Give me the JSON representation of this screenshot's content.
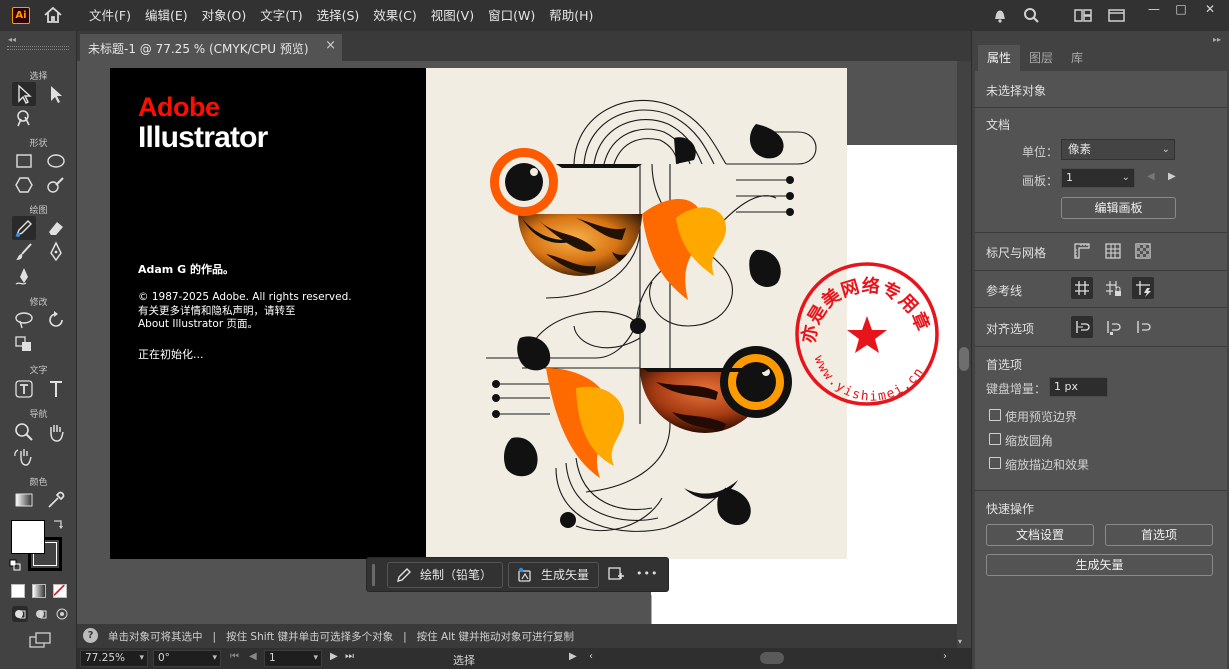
{
  "app": {
    "logo": "Ai",
    "menu": [
      "文件(F)",
      "编辑(E)",
      "对象(O)",
      "文字(T)",
      "选择(S)",
      "效果(C)",
      "视图(V)",
      "窗口(W)",
      "帮助(H)"
    ],
    "window_buttons": [
      "—",
      "□",
      "✕"
    ]
  },
  "document": {
    "tab_title": "未标题-1 @ 77.25 % (CMYK/CPU 预览)",
    "close": "×"
  },
  "toolbar": {
    "groups": [
      "选择",
      "形状",
      "绘图",
      "修改",
      "文字",
      "导航",
      "颜色"
    ]
  },
  "splash": {
    "brand_line1": "Adobe",
    "brand_line2": "Illustrator",
    "author": "Adam G 的作品。",
    "legal_line1": "© 1987-2025 Adobe. All rights reserved.",
    "legal_line2": "有关更多详情和隐私声明，请转至",
    "legal_line3": " About  Illustrator 页面。",
    "status": "正在初始化..."
  },
  "stamp": {
    "text": "亦是美网络专用章",
    "url": "www.yishimei.cn",
    "color": "#e8141b"
  },
  "context_bar": {
    "draw_label": "绘制（铅笔）",
    "vector_label": "生成矢量",
    "more": "•••"
  },
  "tips": {
    "icon": "?",
    "text": "单击对象可将其选中   |   按住 Shift 键并单击可选择多个对象   |   按住 Alt 键并拖动对象可进行复制"
  },
  "status": {
    "zoom": "77.25%",
    "rotation": "0°",
    "artboard": "1",
    "mode": "选择"
  },
  "panel": {
    "tabs": [
      "属性",
      "图层",
      "库"
    ],
    "no_selection": "未选择对象",
    "doc_section": "文档",
    "unit_label": "单位：",
    "unit_value": "像素",
    "artboard_label": "画板：",
    "artboard_value": "1",
    "edit_artboards": "编辑画板",
    "rulers_grids": "标尺与网格",
    "guides": "参考线",
    "align_options": "对齐选项",
    "prefs_section": "首选项",
    "key_incr_label": "键盘增量：",
    "key_incr_value": "1 px",
    "cb_preview_bounds": "使用预览边界",
    "cb_scale_corners": "缩放圆角",
    "cb_scale_strokes": "缩放描边和效果",
    "quick_actions": "快速操作",
    "btn_doc_setup": "文档设置",
    "btn_prefs": "首选项",
    "btn_gen_vector": "生成矢量"
  },
  "colors": {
    "adobe_red": "#fa0f00",
    "splash_bg": "#f1ede3",
    "orange": "#ff6a00",
    "amber": "#ffa800",
    "ai_orange": "#ff9a00"
  }
}
